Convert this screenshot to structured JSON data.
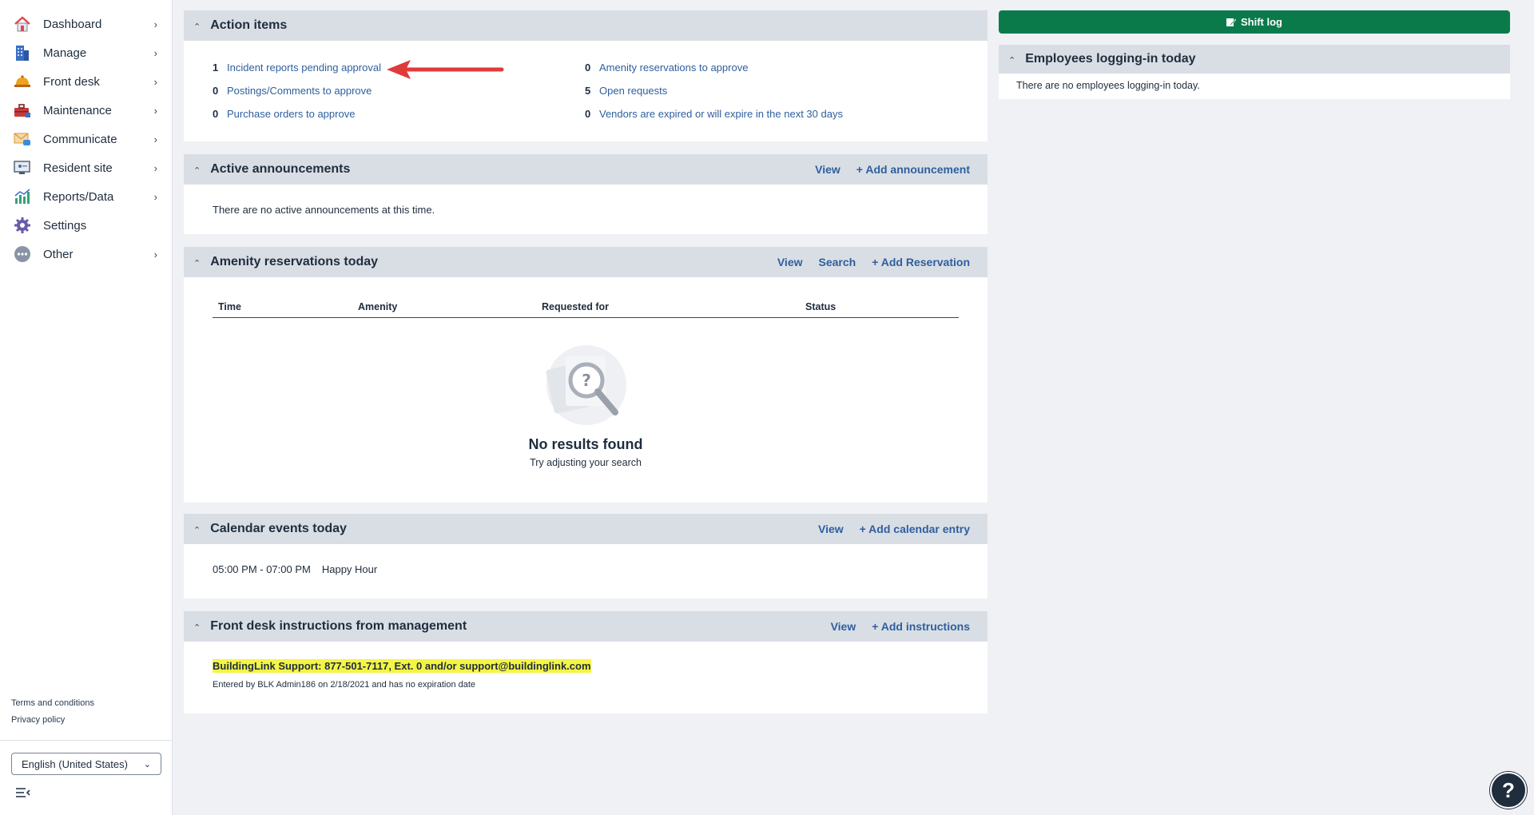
{
  "sidebar": {
    "items": [
      {
        "label": "Dashboard",
        "icon": "house-icon"
      },
      {
        "label": "Manage",
        "icon": "building-icon"
      },
      {
        "label": "Front desk",
        "icon": "bell-icon"
      },
      {
        "label": "Maintenance",
        "icon": "toolbox-icon"
      },
      {
        "label": "Communicate",
        "icon": "envelope-icon"
      },
      {
        "label": "Resident site",
        "icon": "monitor-icon"
      },
      {
        "label": "Reports/Data",
        "icon": "bar-chart-icon"
      },
      {
        "label": "Settings",
        "icon": "gear-icon"
      },
      {
        "label": "Other",
        "icon": "more-icon"
      }
    ],
    "terms": "Terms and conditions",
    "privacy": "Privacy policy",
    "language": "English (United States)"
  },
  "action_items": {
    "title": "Action items",
    "left": [
      {
        "count": "1",
        "label": "Incident reports pending approval"
      },
      {
        "count": "0",
        "label": "Postings/Comments to approve"
      },
      {
        "count": "0",
        "label": "Purchase orders to approve"
      }
    ],
    "right": [
      {
        "count": "0",
        "label": "Amenity reservations to approve"
      },
      {
        "count": "5",
        "label": "Open requests"
      },
      {
        "count": "0",
        "label": "Vendors are expired or will expire in the next 30 days"
      }
    ]
  },
  "announcements": {
    "title": "Active announcements",
    "view": "View",
    "add": "+ Add announcement",
    "empty": "There are no active announcements at this time."
  },
  "amenity": {
    "title": "Amenity reservations today",
    "view": "View",
    "search": "Search",
    "add": "+ Add Reservation",
    "columns": [
      "Time",
      "Amenity",
      "Requested for",
      "Status"
    ],
    "no_results_title": "No results found",
    "no_results_sub": "Try adjusting your search"
  },
  "calendar": {
    "title": "Calendar events today",
    "view": "View",
    "add": "+ Add calendar entry",
    "events": [
      {
        "time": "05:00 PM - 07:00 PM",
        "name": "Happy Hour"
      }
    ]
  },
  "instructions": {
    "title": "Front desk instructions from management",
    "view": "View",
    "add": "+ Add instructions",
    "text": "BuildingLink Support: 877-501-7117, Ext. 0 and/or support@buildinglink.com",
    "note": "Entered by BLK Admin186 on 2/18/2021 and has no expiration date"
  },
  "right_panel": {
    "shift_log": "Shift log",
    "employees_title": "Employees logging-in today",
    "employees_empty": "There are no employees logging-in today."
  },
  "help": "?",
  "colors": {
    "accent": "#2e5f9e",
    "shift_btn": "#0b7a4b",
    "highlight": "#f5f545",
    "arrow": "#e03a3a"
  }
}
